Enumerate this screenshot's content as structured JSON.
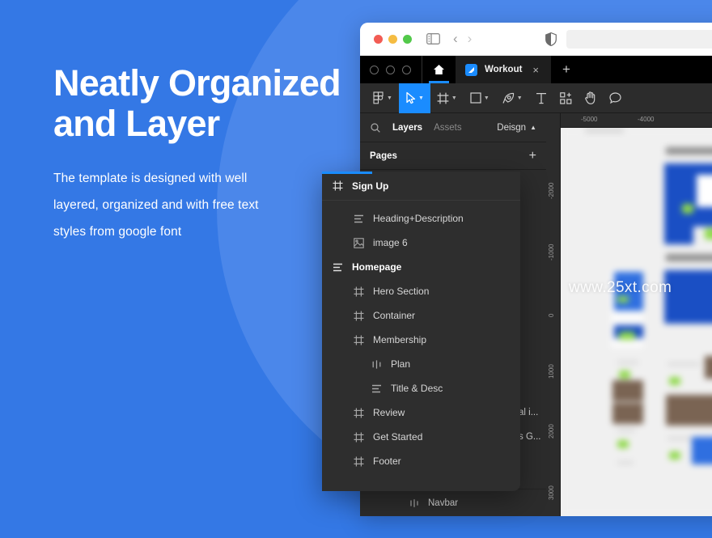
{
  "theme": {
    "brand_blue": "#3478E5",
    "circle_blue": "#4B87EA",
    "accent_blue": "#1A8CFF",
    "panel_dark": "#2C2C2C",
    "overlay_dark": "#2E2E2E",
    "tabstrip_black": "#000000"
  },
  "hero": {
    "title_line1": "Neatly Organized",
    "title_line2": "and Layer",
    "sub_line1": "The template is designed with well",
    "sub_line2": "layered, organized and with free text",
    "sub_line3": "styles from google font"
  },
  "browser": {
    "traffic_lights": [
      "close",
      "minimize",
      "zoom"
    ],
    "sidebar_toggle_icon": "sidebar-icon",
    "back_icon": "chevron-left-icon",
    "forward_icon": "chevron-right-icon",
    "shield_icon": "shield-icon",
    "address_value": "",
    "address_placeholder": ""
  },
  "tabstrip": {
    "ring_count": 3,
    "home_icon": "home-icon",
    "tabs": [
      {
        "label": "Workout",
        "favicon": "figma-file-icon",
        "close_label": "×",
        "active": true
      }
    ],
    "new_tab_label": "+"
  },
  "toolbar": {
    "tools": [
      {
        "name": "move-tools-menu",
        "icon": "figma-logo-icon",
        "caret": true,
        "active": false
      },
      {
        "name": "select-tool",
        "icon": "cursor-icon",
        "caret": true,
        "active": true
      },
      {
        "name": "frame-tool",
        "icon": "frame-icon",
        "caret": true,
        "active": false
      },
      {
        "name": "shape-tool",
        "icon": "square-icon",
        "caret": true,
        "active": false
      },
      {
        "name": "pen-tool",
        "icon": "pen-icon",
        "caret": true,
        "active": false
      },
      {
        "name": "text-tool",
        "icon": "text-icon",
        "caret": false,
        "active": false
      },
      {
        "name": "resources-tool",
        "icon": "components-icon",
        "caret": false,
        "active": false
      },
      {
        "name": "hand-tool",
        "icon": "hand-icon",
        "caret": false,
        "active": false
      },
      {
        "name": "comment-tool",
        "icon": "comment-icon",
        "caret": false,
        "active": false
      }
    ]
  },
  "left_panel": {
    "search_icon": "search-icon",
    "tab_layers": "Layers",
    "tab_assets": "Assets",
    "right_tab": "Deisgn",
    "right_tab_icon": "chevron-up-icon",
    "pages_label": "Pages",
    "pages_add_label": "+",
    "truncated_layers": [
      "al i...",
      "s G..."
    ],
    "bottom_layer": {
      "label": "Navbar",
      "icon": "component-icon"
    }
  },
  "layers_overlay": {
    "header": {
      "label": "Sign Up",
      "icon": "frame-icon"
    },
    "items": [
      {
        "label": "Heading+Description",
        "icon": "text-icon",
        "indent": 1,
        "bold": false
      },
      {
        "label": "image 6",
        "icon": "image-icon",
        "indent": 1,
        "bold": false
      },
      {
        "label": "Homepage",
        "icon": "text-icon",
        "indent": 0,
        "bold": true
      },
      {
        "label": "Hero Section",
        "icon": "frame-icon",
        "indent": 1,
        "bold": false
      },
      {
        "label": "Container",
        "icon": "frame-icon",
        "indent": 1,
        "bold": false
      },
      {
        "label": "Membership",
        "icon": "frame-icon",
        "indent": 1,
        "bold": false
      },
      {
        "label": "Plan",
        "icon": "component-icon",
        "indent": 2,
        "bold": false
      },
      {
        "label": "Title & Desc",
        "icon": "text-icon",
        "indent": 2,
        "bold": false
      },
      {
        "label": "Review",
        "icon": "frame-icon",
        "indent": 1,
        "bold": false
      },
      {
        "label": "Get Started",
        "icon": "frame-icon",
        "indent": 1,
        "bold": false
      },
      {
        "label": "Footer",
        "icon": "frame-icon",
        "indent": 1,
        "bold": false
      }
    ]
  },
  "canvas": {
    "watermark": "www.25xt.com",
    "ruler_h_ticks": [
      "-5000",
      "-4000"
    ],
    "ruler_v_ticks": [
      "-2000",
      "-1000",
      "0",
      "1000",
      "2000",
      "3000"
    ]
  }
}
